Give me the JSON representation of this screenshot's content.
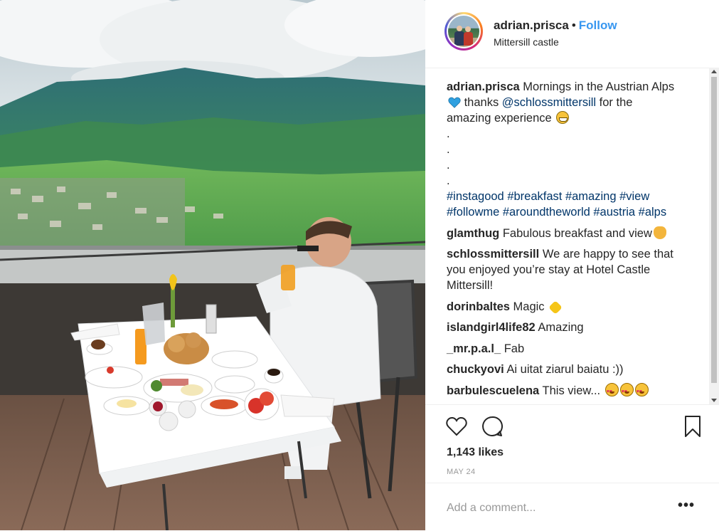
{
  "post": {
    "username": "adrian.prisca",
    "separator": "•",
    "follow_label": "Follow",
    "location": "Mittersill castle"
  },
  "caption": {
    "username": "adrian.prisca",
    "line1": " Mornings in the Austrian Alps",
    "line2_pre": " thanks ",
    "mention": "@schlossmittersill",
    "line2_post": " for the",
    "line3": "amazing experience ",
    "dot": ".",
    "hashtags_line1": "#instagood #breakfast #amazing #view",
    "hashtags_line2": "#followme #aroundtheworld #austria #alps"
  },
  "comments": [
    {
      "user": "glamthug",
      "text": " Fabulous breakfast and view"
    },
    {
      "user": "schlossmittersill",
      "text": " We are happy to see that",
      "text2": "you enjoyed you’re stay at Hotel Castle",
      "text3": "Mittersill!"
    },
    {
      "user": "dorinbaltes",
      "text": " Magic "
    },
    {
      "user": "islandgirl4life82",
      "text": " Amazing"
    },
    {
      "user": "_mr.p.a.l_",
      "text": " Fab"
    },
    {
      "user": "chuckyovi",
      "text": " Ai uitat ziarul baiatu :))"
    },
    {
      "user": "barbulescuelena",
      "text": " This view... "
    }
  ],
  "engagement": {
    "likes": "1,143 likes",
    "date": "MAY 24"
  },
  "comment_box": {
    "placeholder": "Add a comment...",
    "more_label": "•••"
  },
  "icons": {
    "like": "heart-icon",
    "comment": "comment-bubble-icon",
    "save": "bookmark-icon",
    "options": "more-options-icon"
  },
  "colors": {
    "follow": "#3897f0",
    "link": "#003569",
    "text": "#262626",
    "muted": "#999999"
  }
}
